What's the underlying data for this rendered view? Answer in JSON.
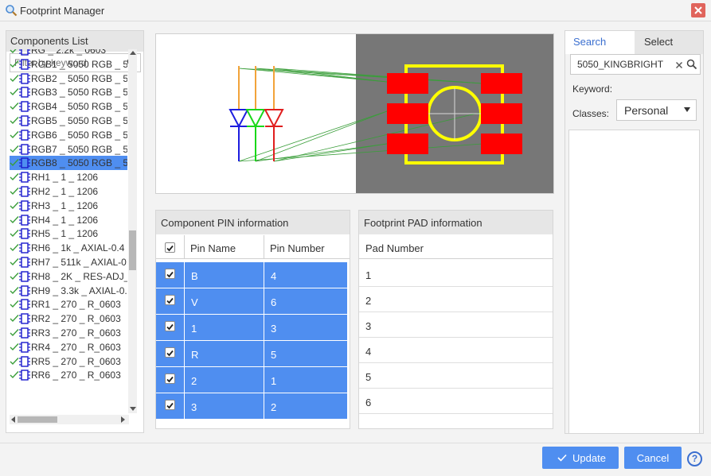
{
  "window": {
    "title": "Footprint Manager"
  },
  "components_list": {
    "header": "Components List",
    "filter_placeholder": "Filter by keyword",
    "items": [
      "RG _ 2.2k _ 0603",
      "RGB1 _ 5050 RGB _ 5",
      "RGB2 _ 5050 RGB _ 5",
      "RGB3 _ 5050 RGB _ 5",
      "RGB4 _ 5050 RGB _ 5",
      "RGB5 _ 5050 RGB _ 5",
      "RGB6 _ 5050 RGB _ 5",
      "RGB7 _ 5050 RGB _ 5",
      "RGB8 _ 5050 RGB _ 5",
      "RH1 _ 1 _ 1206",
      "RH2 _ 1 _ 1206",
      "RH3 _ 1 _ 1206",
      "RH4 _ 1 _ 1206",
      "RH5 _ 1 _ 1206",
      "RH6 _ 1k _ AXIAL-0.4",
      "RH7 _ 511k _ AXIAL-0",
      "RH8 _ 2K _ RES-ADJ_",
      "RH9 _ 3.3k _ AXIAL-0.",
      "RR1 _ 270 _ R_0603",
      "RR2 _ 270 _ R_0603",
      "RR3 _ 270 _ R_0603",
      "RR4 _ 270 _ R_0603",
      "RR5 _ 270 _ R_0603",
      "RR6 _ 270 _ R_0603"
    ],
    "selected_item": "RGB8 _ 5050 RGB _ 5"
  },
  "pin_info": {
    "header": "Component PIN information",
    "col_name": "Pin Name",
    "col_number": "Pin Number",
    "rows": [
      {
        "name": "B",
        "number": "4"
      },
      {
        "name": "V",
        "number": "6"
      },
      {
        "name": "1",
        "number": "3"
      },
      {
        "name": "R",
        "number": "5"
      },
      {
        "name": "2",
        "number": "1"
      },
      {
        "name": "3",
        "number": "2"
      }
    ]
  },
  "pad_info": {
    "header": "Footprint PAD information",
    "col_number": "Pad Number",
    "rows": [
      "1",
      "2",
      "3",
      "4",
      "5",
      "6"
    ]
  },
  "search_panel": {
    "tab_search": "Search",
    "tab_select": "Select",
    "search_value": "5050_KINGBRIGHT",
    "keyword_label": "Keyword:",
    "classes_label": "Classes:",
    "classes_value": "Personal"
  },
  "footer": {
    "update_label": "Update",
    "cancel_label": "Cancel",
    "help_label": "?"
  },
  "colors": {
    "accent": "#4f8ef0",
    "pad_red": "#ff0000",
    "silk_yellow": "#ffff00",
    "pcb_bg": "#777777"
  }
}
